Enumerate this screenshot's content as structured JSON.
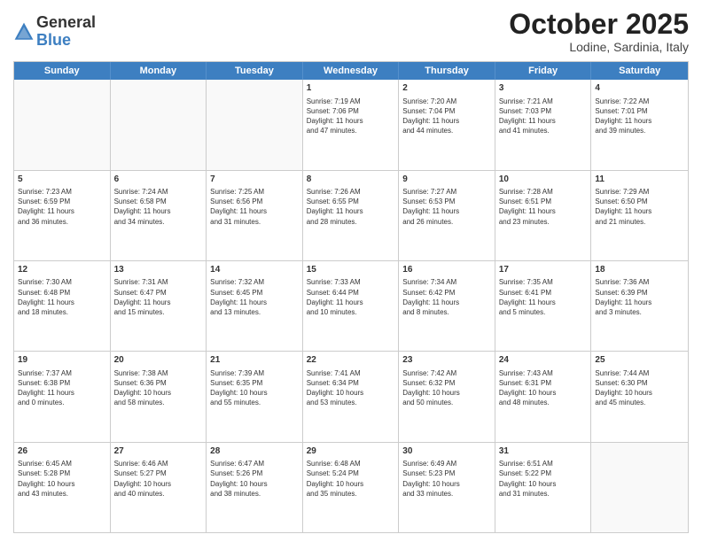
{
  "header": {
    "logo_general": "General",
    "logo_blue": "Blue",
    "month_title": "October 2025",
    "location": "Lodine, Sardinia, Italy"
  },
  "days_of_week": [
    "Sunday",
    "Monday",
    "Tuesday",
    "Wednesday",
    "Thursday",
    "Friday",
    "Saturday"
  ],
  "rows": [
    [
      {
        "day": "",
        "text": ""
      },
      {
        "day": "",
        "text": ""
      },
      {
        "day": "",
        "text": ""
      },
      {
        "day": "1",
        "text": "Sunrise: 7:19 AM\nSunset: 7:06 PM\nDaylight: 11 hours\nand 47 minutes."
      },
      {
        "day": "2",
        "text": "Sunrise: 7:20 AM\nSunset: 7:04 PM\nDaylight: 11 hours\nand 44 minutes."
      },
      {
        "day": "3",
        "text": "Sunrise: 7:21 AM\nSunset: 7:03 PM\nDaylight: 11 hours\nand 41 minutes."
      },
      {
        "day": "4",
        "text": "Sunrise: 7:22 AM\nSunset: 7:01 PM\nDaylight: 11 hours\nand 39 minutes."
      }
    ],
    [
      {
        "day": "5",
        "text": "Sunrise: 7:23 AM\nSunset: 6:59 PM\nDaylight: 11 hours\nand 36 minutes."
      },
      {
        "day": "6",
        "text": "Sunrise: 7:24 AM\nSunset: 6:58 PM\nDaylight: 11 hours\nand 34 minutes."
      },
      {
        "day": "7",
        "text": "Sunrise: 7:25 AM\nSunset: 6:56 PM\nDaylight: 11 hours\nand 31 minutes."
      },
      {
        "day": "8",
        "text": "Sunrise: 7:26 AM\nSunset: 6:55 PM\nDaylight: 11 hours\nand 28 minutes."
      },
      {
        "day": "9",
        "text": "Sunrise: 7:27 AM\nSunset: 6:53 PM\nDaylight: 11 hours\nand 26 minutes."
      },
      {
        "day": "10",
        "text": "Sunrise: 7:28 AM\nSunset: 6:51 PM\nDaylight: 11 hours\nand 23 minutes."
      },
      {
        "day": "11",
        "text": "Sunrise: 7:29 AM\nSunset: 6:50 PM\nDaylight: 11 hours\nand 21 minutes."
      }
    ],
    [
      {
        "day": "12",
        "text": "Sunrise: 7:30 AM\nSunset: 6:48 PM\nDaylight: 11 hours\nand 18 minutes."
      },
      {
        "day": "13",
        "text": "Sunrise: 7:31 AM\nSunset: 6:47 PM\nDaylight: 11 hours\nand 15 minutes."
      },
      {
        "day": "14",
        "text": "Sunrise: 7:32 AM\nSunset: 6:45 PM\nDaylight: 11 hours\nand 13 minutes."
      },
      {
        "day": "15",
        "text": "Sunrise: 7:33 AM\nSunset: 6:44 PM\nDaylight: 11 hours\nand 10 minutes."
      },
      {
        "day": "16",
        "text": "Sunrise: 7:34 AM\nSunset: 6:42 PM\nDaylight: 11 hours\nand 8 minutes."
      },
      {
        "day": "17",
        "text": "Sunrise: 7:35 AM\nSunset: 6:41 PM\nDaylight: 11 hours\nand 5 minutes."
      },
      {
        "day": "18",
        "text": "Sunrise: 7:36 AM\nSunset: 6:39 PM\nDaylight: 11 hours\nand 3 minutes."
      }
    ],
    [
      {
        "day": "19",
        "text": "Sunrise: 7:37 AM\nSunset: 6:38 PM\nDaylight: 11 hours\nand 0 minutes."
      },
      {
        "day": "20",
        "text": "Sunrise: 7:38 AM\nSunset: 6:36 PM\nDaylight: 10 hours\nand 58 minutes."
      },
      {
        "day": "21",
        "text": "Sunrise: 7:39 AM\nSunset: 6:35 PM\nDaylight: 10 hours\nand 55 minutes."
      },
      {
        "day": "22",
        "text": "Sunrise: 7:41 AM\nSunset: 6:34 PM\nDaylight: 10 hours\nand 53 minutes."
      },
      {
        "day": "23",
        "text": "Sunrise: 7:42 AM\nSunset: 6:32 PM\nDaylight: 10 hours\nand 50 minutes."
      },
      {
        "day": "24",
        "text": "Sunrise: 7:43 AM\nSunset: 6:31 PM\nDaylight: 10 hours\nand 48 minutes."
      },
      {
        "day": "25",
        "text": "Sunrise: 7:44 AM\nSunset: 6:30 PM\nDaylight: 10 hours\nand 45 minutes."
      }
    ],
    [
      {
        "day": "26",
        "text": "Sunrise: 6:45 AM\nSunset: 5:28 PM\nDaylight: 10 hours\nand 43 minutes."
      },
      {
        "day": "27",
        "text": "Sunrise: 6:46 AM\nSunset: 5:27 PM\nDaylight: 10 hours\nand 40 minutes."
      },
      {
        "day": "28",
        "text": "Sunrise: 6:47 AM\nSunset: 5:26 PM\nDaylight: 10 hours\nand 38 minutes."
      },
      {
        "day": "29",
        "text": "Sunrise: 6:48 AM\nSunset: 5:24 PM\nDaylight: 10 hours\nand 35 minutes."
      },
      {
        "day": "30",
        "text": "Sunrise: 6:49 AM\nSunset: 5:23 PM\nDaylight: 10 hours\nand 33 minutes."
      },
      {
        "day": "31",
        "text": "Sunrise: 6:51 AM\nSunset: 5:22 PM\nDaylight: 10 hours\nand 31 minutes."
      },
      {
        "day": "",
        "text": ""
      }
    ]
  ]
}
